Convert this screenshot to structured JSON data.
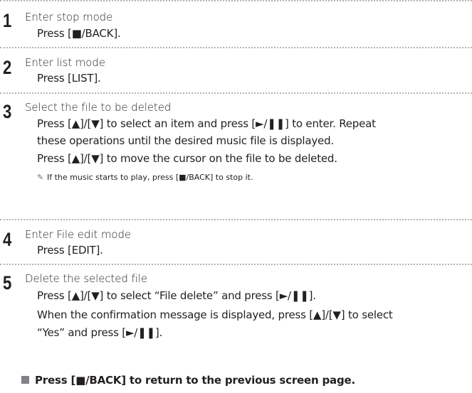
{
  "steps": [
    {
      "number": "1",
      "title": "Enter stop mode",
      "lines": [
        "Press [■/BACK]."
      ]
    },
    {
      "number": "2",
      "title": "Enter list mode",
      "lines": [
        "Press [LIST]."
      ]
    },
    {
      "number": "3",
      "title": "Select the file to be deleted",
      "lines": [
        "Press [▲]/[▼] to select an item and press [►/❚❚] to enter. Repeat",
        "these operations until the desired music file is displayed.",
        "Press [▲]/[▼] to move the cursor on the file to be deleted."
      ],
      "note": "If the music starts to play, press [■/BACK] to stop it."
    },
    {
      "number": "4",
      "title": "Enter File edit mode",
      "lines": [
        "Press [EDIT]."
      ]
    },
    {
      "number": "5",
      "title": "Delete the selected file",
      "lines": [
        "Press [▲]/[▼] to select “File delete” and press [►/❚❚].",
        "When the confirmation message is displayed, press [▲]/[▼] to select",
        "“Yes” and press [►/❚❚]."
      ]
    }
  ],
  "footer_note": "Press [■/BACK] to return to the previous screen page.",
  "icons": {
    "note": "pencil-icon",
    "footer": "square-bullet-icon"
  },
  "colors": {
    "text": "#231f20",
    "divider": "#b3b3b3",
    "bullet": "#808285"
  }
}
